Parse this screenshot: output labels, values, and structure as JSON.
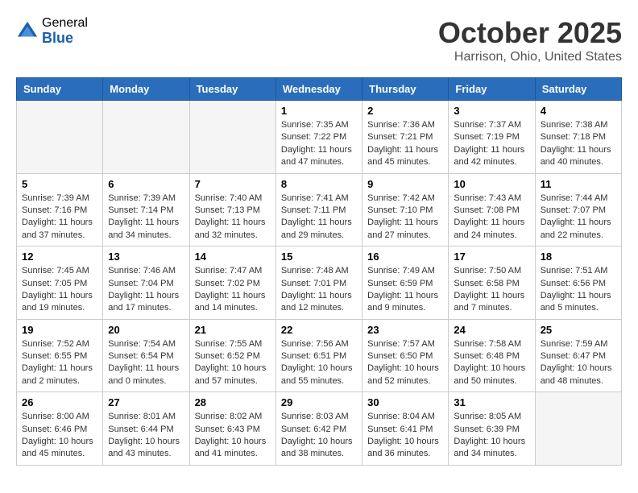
{
  "header": {
    "logo_general": "General",
    "logo_blue": "Blue",
    "month_title": "October 2025",
    "location": "Harrison, Ohio, United States"
  },
  "days_of_week": [
    "Sunday",
    "Monday",
    "Tuesday",
    "Wednesday",
    "Thursday",
    "Friday",
    "Saturday"
  ],
  "weeks": [
    [
      {
        "day": "",
        "info": ""
      },
      {
        "day": "",
        "info": ""
      },
      {
        "day": "",
        "info": ""
      },
      {
        "day": "1",
        "info": "Sunrise: 7:35 AM\nSunset: 7:22 PM\nDaylight: 11 hours\nand 47 minutes."
      },
      {
        "day": "2",
        "info": "Sunrise: 7:36 AM\nSunset: 7:21 PM\nDaylight: 11 hours\nand 45 minutes."
      },
      {
        "day": "3",
        "info": "Sunrise: 7:37 AM\nSunset: 7:19 PM\nDaylight: 11 hours\nand 42 minutes."
      },
      {
        "day": "4",
        "info": "Sunrise: 7:38 AM\nSunset: 7:18 PM\nDaylight: 11 hours\nand 40 minutes."
      }
    ],
    [
      {
        "day": "5",
        "info": "Sunrise: 7:39 AM\nSunset: 7:16 PM\nDaylight: 11 hours\nand 37 minutes."
      },
      {
        "day": "6",
        "info": "Sunrise: 7:39 AM\nSunset: 7:14 PM\nDaylight: 11 hours\nand 34 minutes."
      },
      {
        "day": "7",
        "info": "Sunrise: 7:40 AM\nSunset: 7:13 PM\nDaylight: 11 hours\nand 32 minutes."
      },
      {
        "day": "8",
        "info": "Sunrise: 7:41 AM\nSunset: 7:11 PM\nDaylight: 11 hours\nand 29 minutes."
      },
      {
        "day": "9",
        "info": "Sunrise: 7:42 AM\nSunset: 7:10 PM\nDaylight: 11 hours\nand 27 minutes."
      },
      {
        "day": "10",
        "info": "Sunrise: 7:43 AM\nSunset: 7:08 PM\nDaylight: 11 hours\nand 24 minutes."
      },
      {
        "day": "11",
        "info": "Sunrise: 7:44 AM\nSunset: 7:07 PM\nDaylight: 11 hours\nand 22 minutes."
      }
    ],
    [
      {
        "day": "12",
        "info": "Sunrise: 7:45 AM\nSunset: 7:05 PM\nDaylight: 11 hours\nand 19 minutes."
      },
      {
        "day": "13",
        "info": "Sunrise: 7:46 AM\nSunset: 7:04 PM\nDaylight: 11 hours\nand 17 minutes."
      },
      {
        "day": "14",
        "info": "Sunrise: 7:47 AM\nSunset: 7:02 PM\nDaylight: 11 hours\nand 14 minutes."
      },
      {
        "day": "15",
        "info": "Sunrise: 7:48 AM\nSunset: 7:01 PM\nDaylight: 11 hours\nand 12 minutes."
      },
      {
        "day": "16",
        "info": "Sunrise: 7:49 AM\nSunset: 6:59 PM\nDaylight: 11 hours\nand 9 minutes."
      },
      {
        "day": "17",
        "info": "Sunrise: 7:50 AM\nSunset: 6:58 PM\nDaylight: 11 hours\nand 7 minutes."
      },
      {
        "day": "18",
        "info": "Sunrise: 7:51 AM\nSunset: 6:56 PM\nDaylight: 11 hours\nand 5 minutes."
      }
    ],
    [
      {
        "day": "19",
        "info": "Sunrise: 7:52 AM\nSunset: 6:55 PM\nDaylight: 11 hours\nand 2 minutes."
      },
      {
        "day": "20",
        "info": "Sunrise: 7:54 AM\nSunset: 6:54 PM\nDaylight: 11 hours\nand 0 minutes."
      },
      {
        "day": "21",
        "info": "Sunrise: 7:55 AM\nSunset: 6:52 PM\nDaylight: 10 hours\nand 57 minutes."
      },
      {
        "day": "22",
        "info": "Sunrise: 7:56 AM\nSunset: 6:51 PM\nDaylight: 10 hours\nand 55 minutes."
      },
      {
        "day": "23",
        "info": "Sunrise: 7:57 AM\nSunset: 6:50 PM\nDaylight: 10 hours\nand 52 minutes."
      },
      {
        "day": "24",
        "info": "Sunrise: 7:58 AM\nSunset: 6:48 PM\nDaylight: 10 hours\nand 50 minutes."
      },
      {
        "day": "25",
        "info": "Sunrise: 7:59 AM\nSunset: 6:47 PM\nDaylight: 10 hours\nand 48 minutes."
      }
    ],
    [
      {
        "day": "26",
        "info": "Sunrise: 8:00 AM\nSunset: 6:46 PM\nDaylight: 10 hours\nand 45 minutes."
      },
      {
        "day": "27",
        "info": "Sunrise: 8:01 AM\nSunset: 6:44 PM\nDaylight: 10 hours\nand 43 minutes."
      },
      {
        "day": "28",
        "info": "Sunrise: 8:02 AM\nSunset: 6:43 PM\nDaylight: 10 hours\nand 41 minutes."
      },
      {
        "day": "29",
        "info": "Sunrise: 8:03 AM\nSunset: 6:42 PM\nDaylight: 10 hours\nand 38 minutes."
      },
      {
        "day": "30",
        "info": "Sunrise: 8:04 AM\nSunset: 6:41 PM\nDaylight: 10 hours\nand 36 minutes."
      },
      {
        "day": "31",
        "info": "Sunrise: 8:05 AM\nSunset: 6:39 PM\nDaylight: 10 hours\nand 34 minutes."
      },
      {
        "day": "",
        "info": ""
      }
    ]
  ]
}
